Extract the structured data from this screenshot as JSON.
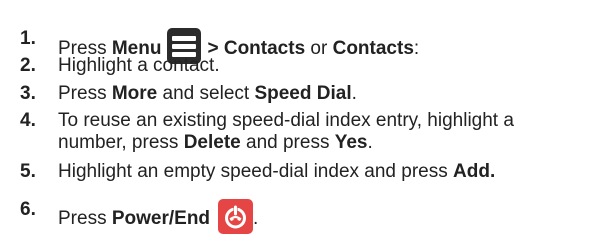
{
  "steps": [
    {
      "num": "1.",
      "press": "Press",
      "menu": "Menu",
      "gt_contacts": "> Contacts",
      "or": "or",
      "contacts": "Contacts",
      "colon": ":",
      "icon": "menu-icon"
    },
    {
      "num": "2.",
      "text": "Highlight a contact."
    },
    {
      "num": "3.",
      "press": "Press",
      "more": "More",
      "and_select": "and select",
      "speed_dial": "Speed Dial",
      "period": "."
    },
    {
      "num": "4.",
      "line1": "To reuse an existing speed-dial index entry, highlight a",
      "line2a": "number, press",
      "delete": "Delete",
      "and_press": "and press",
      "yes": "Yes",
      "period": "."
    },
    {
      "num": "5.",
      "text": "Highlight an empty speed-dial index and press",
      "add": "Add."
    },
    {
      "num": "6.",
      "press": "Press",
      "power_end": "Power/End",
      "period": ".",
      "icon": "power-end-icon"
    }
  ],
  "colors": {
    "text": "#222222",
    "menu_icon": "#2b2b2b",
    "power_icon": "#e64545"
  }
}
